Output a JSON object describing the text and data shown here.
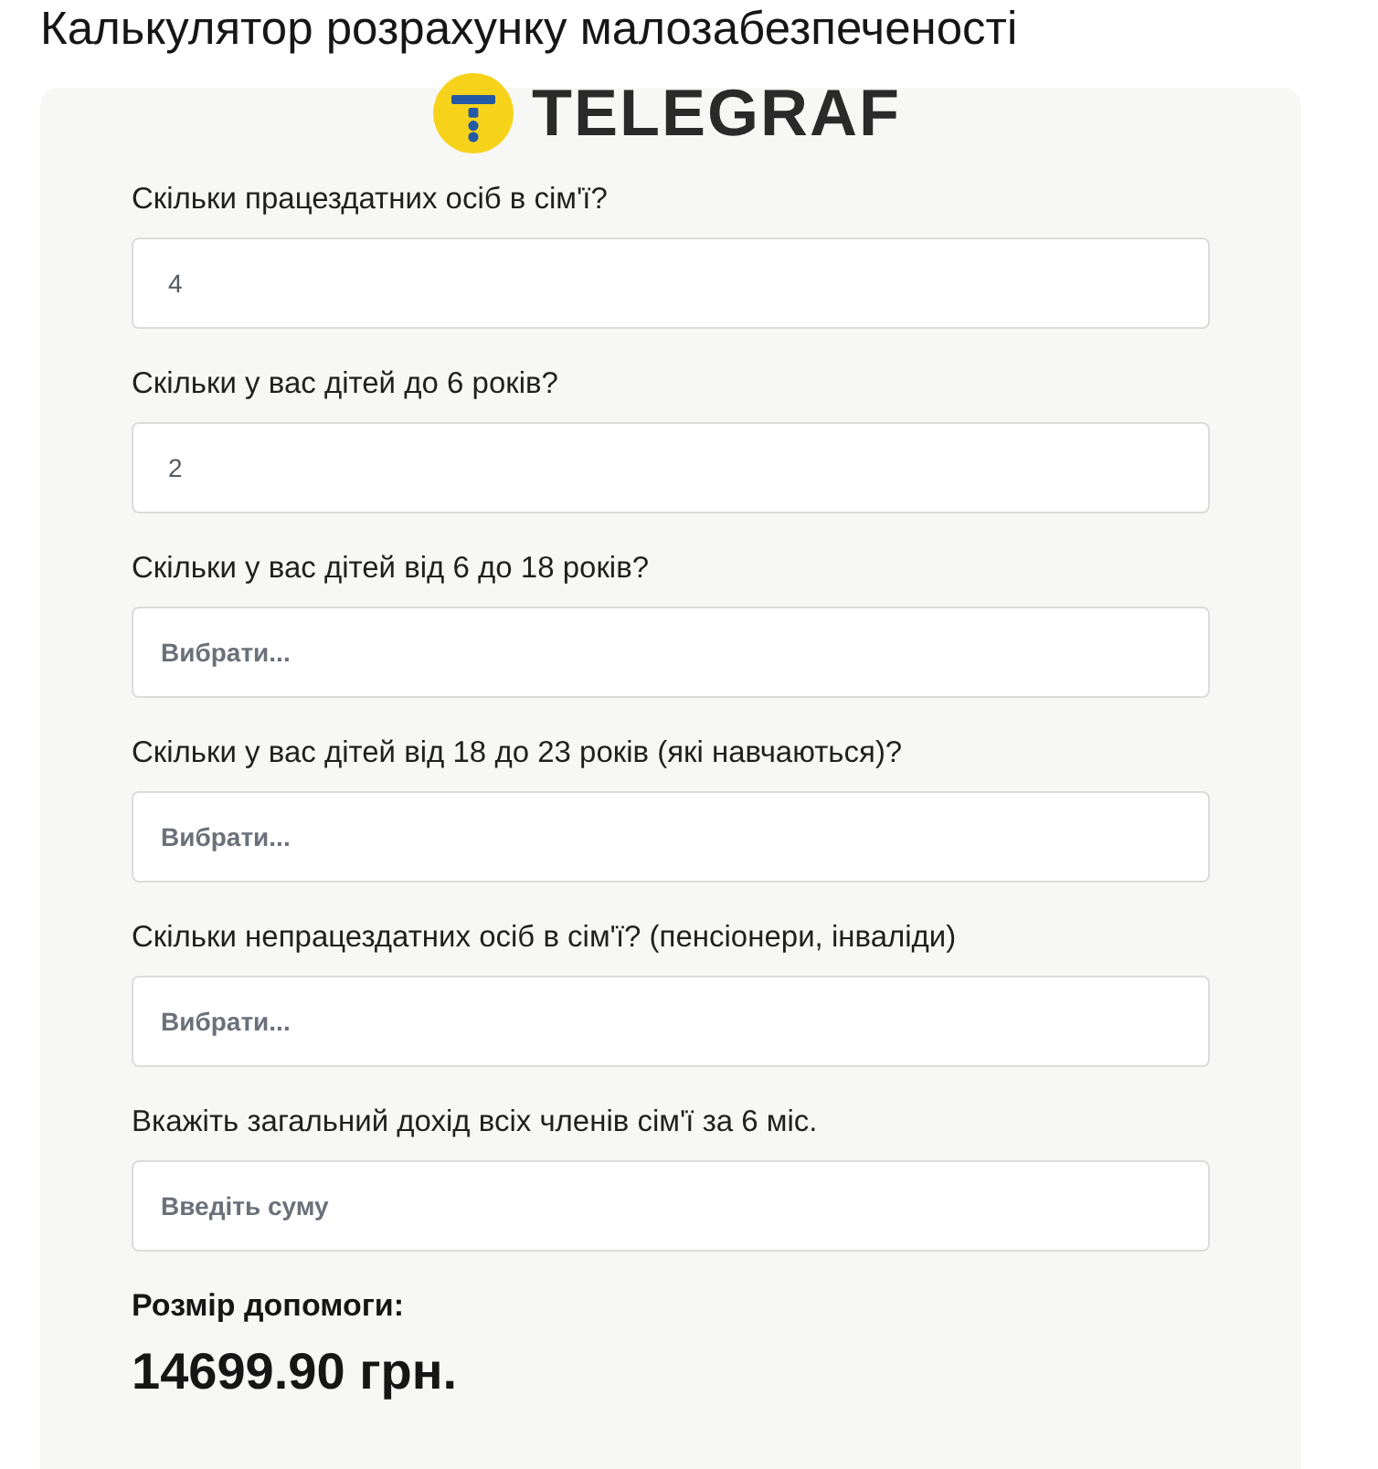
{
  "page": {
    "title": "Калькулятор розрахунку малозабезпеченості"
  },
  "logo": {
    "text": "TELEGRAF"
  },
  "fields": [
    {
      "label": "Скільки працездатних осіб в сім'ї?",
      "value": "4"
    },
    {
      "label": "Скільки у вас дітей до 6 років?",
      "value": "2"
    },
    {
      "label": "Скільки у вас дітей від 6 до 18 років?",
      "placeholder": "Вибрати..."
    },
    {
      "label": "Скільки у вас дітей від 18 до 23 років (які навчаються)?",
      "placeholder": "Вибрати..."
    },
    {
      "label": "Скільки непрацездатних осіб в сім'ї? (пенсіонери, інваліди)",
      "placeholder": "Вибрати..."
    },
    {
      "label": "Вкажіть загальний дохід всіх членів сім'ї за 6 міс.",
      "placeholder": "Введіть суму"
    }
  ],
  "result": {
    "label": "Розмір допомоги:",
    "amount": "14699.90 грн."
  }
}
